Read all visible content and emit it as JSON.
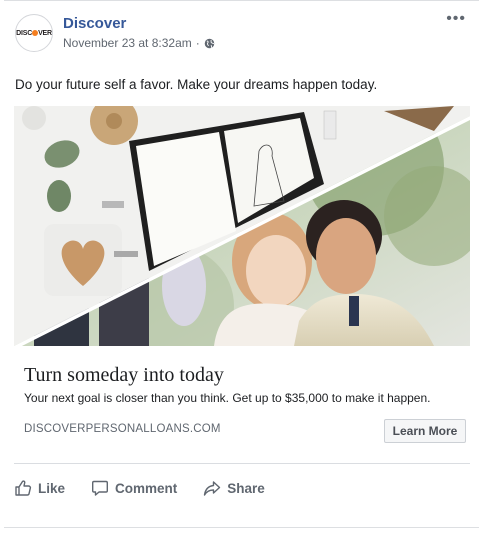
{
  "post": {
    "page_name": "Discover",
    "logo_text": "DISC",
    "logo_text_end": "VER",
    "timestamp": "November 23 at 8:32am",
    "separator": "·",
    "message": "Do your future self a favor. Make your dreams happen today."
  },
  "ad": {
    "headline": "Turn someday into today",
    "description": "Your next goal is closer than you think. Get up to $35,000 to make it happen.",
    "domain": "DISCOVERPERSONALLOANS.COM",
    "cta_label": "Learn More"
  },
  "actions": [
    {
      "label": "Like",
      "icon": "thumbs-up-icon"
    },
    {
      "label": "Comment",
      "icon": "comment-icon"
    },
    {
      "label": "Share",
      "icon": "share-icon"
    }
  ],
  "colors": {
    "brand_link": "#365899",
    "brand_orange": "#f47e20",
    "muted_text": "#606770"
  }
}
